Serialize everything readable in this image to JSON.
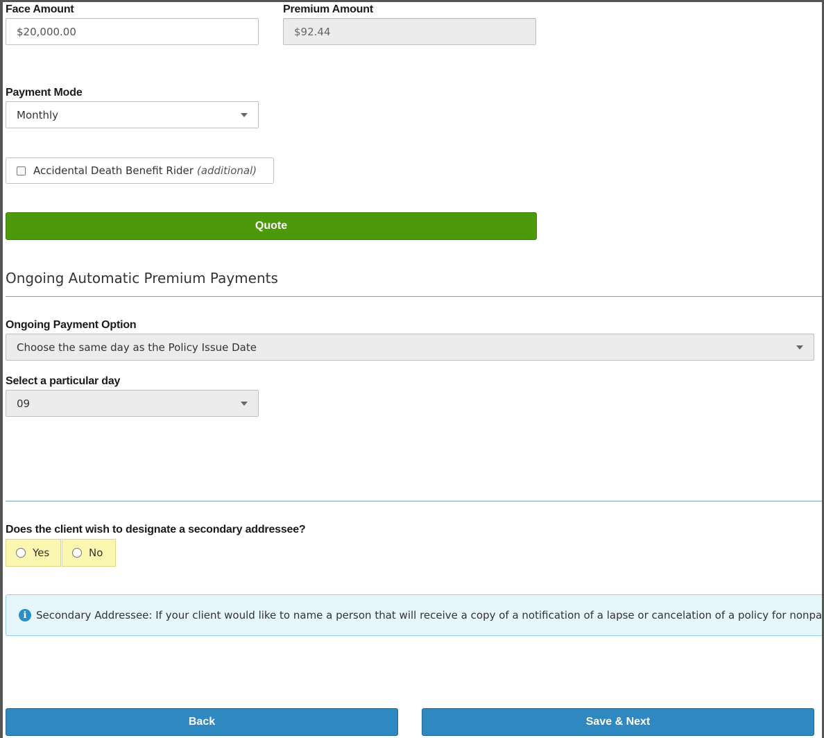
{
  "face_amount": {
    "label": "Face Amount",
    "value": "$20,000.00"
  },
  "premium_amount": {
    "label": "Premium Amount",
    "value": "$92.44"
  },
  "payment_mode": {
    "label": "Payment Mode",
    "value": "Monthly"
  },
  "rider": {
    "label": "Accidental Death Benefit Rider",
    "note": "(additional)",
    "checked": false
  },
  "quote_button": "Quote",
  "section_title": "Ongoing Automatic Premium Payments",
  "ongoing_payment": {
    "label": "Ongoing Payment Option",
    "value": "Choose the same day as the Policy Issue Date"
  },
  "particular_day": {
    "label": "Select a particular day",
    "value": "09"
  },
  "secondary_addressee": {
    "question": "Does the client wish to designate a secondary addressee?",
    "options": [
      "Yes",
      "No"
    ]
  },
  "info_text": "Secondary Addressee: If your client would like to name a person that will receive a copy of a notification of a lapse or cancelation of a policy for nonpay",
  "buttons": {
    "back": "Back",
    "save_next": "Save & Next"
  },
  "colors": {
    "quote": "#4c9a0c",
    "nav": "#2f88c0",
    "info_bg": "#e6f6fb",
    "radio_bg": "#fbf7b0"
  }
}
